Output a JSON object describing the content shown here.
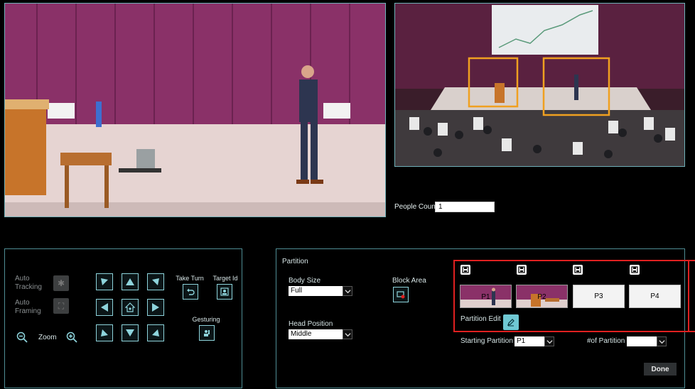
{
  "people_count": {
    "label": "People Count",
    "value": "1"
  },
  "controls": {
    "auto_tracking_label": "Auto\nTracking",
    "auto_framing_label": "Auto\nFraming",
    "zoom_label": "Zoom",
    "take_turn_label": "Take Turn",
    "target_id_label": "Target Id",
    "gesturing_label": "Gesturing"
  },
  "partition": {
    "title": "Partition",
    "body_size_label": "Body Size",
    "body_size_value": "Full",
    "head_position_label": "Head Position",
    "head_position_value": "Middle",
    "block_area_label": "Block Area",
    "partition_edit_label": "Partition Edit",
    "thumbs": [
      {
        "label": "P1"
      },
      {
        "label": "P2"
      },
      {
        "label": "P3"
      },
      {
        "label": "P4"
      }
    ],
    "starting_partition_label": "Starting Partition",
    "starting_partition_value": "P1",
    "num_partition_label": "#of Partition",
    "num_partition_value": "",
    "done_label": "Done"
  },
  "colors": {
    "accent": "#6fc8d3",
    "highlight": "#e02020",
    "frame": "#f0a020"
  }
}
